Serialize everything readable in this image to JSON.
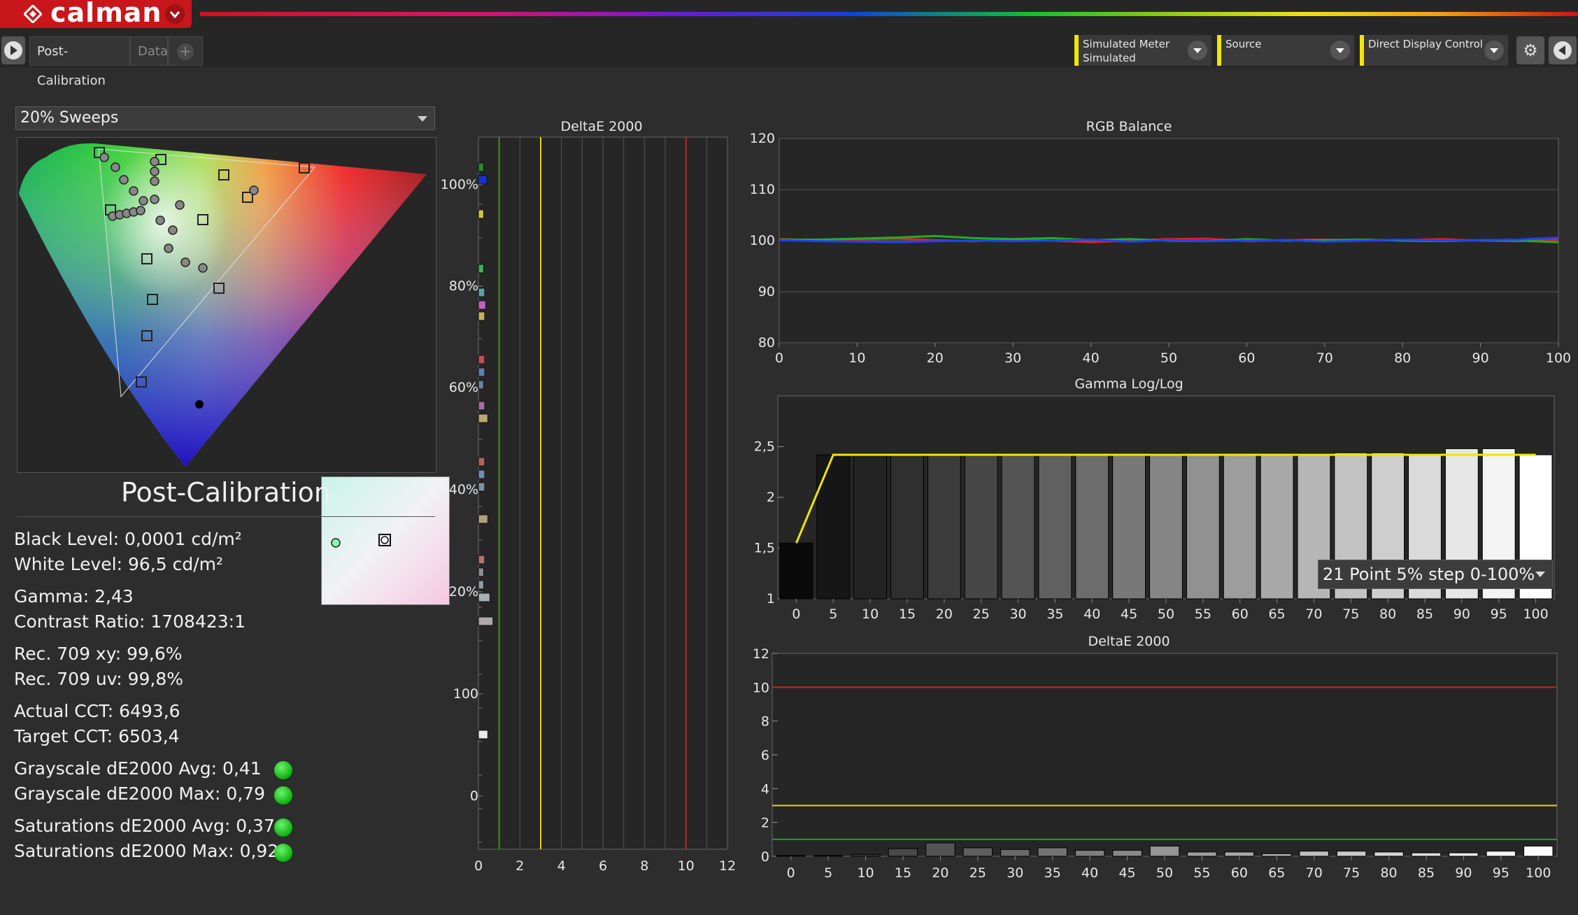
{
  "app": {
    "name": "calman"
  },
  "tabs": [
    {
      "label": "Post-Calibration",
      "active": true
    },
    {
      "label": "Data",
      "active": false
    }
  ],
  "devices": {
    "meter_label": "Simulated Meter",
    "meter_value": "Simulated",
    "source_label": "Source",
    "display_label": "Direct Display Control"
  },
  "sweep": {
    "selected": "20% Sweeps"
  },
  "panel": {
    "title": "Post-Calibration",
    "black_level": "Black Level: 0,0001 cd/m²",
    "white_level": "White Level: 96,5 cd/m²",
    "gamma": "Gamma: 2,43",
    "contrast": "Contrast Ratio: 1708423:1",
    "rec709_xy": "Rec. 709 xy: 99,6%",
    "rec709_uv": "Rec. 709 uv: 99,8%",
    "actual_cct": "Actual CCT: 6493,6",
    "target_cct": "Target CCT: 6503,4",
    "gs_avg": "Grayscale dE2000 Avg: 0,41",
    "gs_max": "Grayscale dE2000 Max: 0,79",
    "sat_avg": "Saturations dE2000 Avg: 0,37",
    "sat_max": "Saturations dE2000 Max: 0,92",
    "status_color": "#1ebe1e"
  },
  "gamma_select": {
    "selected": "21 Point 5% step 0-100%"
  },
  "chart_data": [
    {
      "type": "bar",
      "title": "DeltaE 2000",
      "orientation": "horizontal",
      "xlim": [
        0,
        12
      ],
      "xticks": [
        "0",
        "2",
        "4",
        "6",
        "8",
        "10",
        "12"
      ],
      "ytick_labels": [
        "100%",
        "80%",
        "60%",
        "40%",
        "20%",
        "100",
        "0"
      ],
      "thresholds": [
        {
          "value": 1,
          "color": "#20a020"
        },
        {
          "value": 3,
          "color": "#e6d600"
        },
        {
          "value": 10,
          "color": "#d02020"
        }
      ],
      "bars": [
        {
          "value": 0.25,
          "color": "#2a8a2a"
        },
        {
          "value": 0.4,
          "color": "#1a30d0"
        },
        {
          "value": 0.25,
          "color": "#c8c840"
        },
        {
          "value": 0.25,
          "color": "#40b060"
        },
        {
          "value": 0.3,
          "color": "#60a0a0"
        },
        {
          "value": 0.35,
          "color": "#c060c0"
        },
        {
          "value": 0.3,
          "color": "#c8b060"
        },
        {
          "value": 0.3,
          "color": "#c05050"
        },
        {
          "value": 0.3,
          "color": "#6080b0"
        },
        {
          "value": 0.25,
          "color": "#7080a0"
        },
        {
          "value": 0.3,
          "color": "#a070a0"
        },
        {
          "value": 0.45,
          "color": "#b8a870"
        },
        {
          "value": 0.3,
          "color": "#b06060"
        },
        {
          "value": 0.3,
          "color": "#7090b0"
        },
        {
          "value": 0.3,
          "color": "#8090a0"
        },
        {
          "value": 0.45,
          "color": "#b0a080"
        },
        {
          "value": 0.3,
          "color": "#b07070"
        },
        {
          "value": 0.25,
          "color": "#909090"
        },
        {
          "value": 0.25,
          "color": "#909aa8"
        },
        {
          "value": 0.55,
          "color": "#a8b0b8"
        },
        {
          "value": 0.7,
          "color": "#b0a8a8"
        },
        {
          "value": 0.45,
          "color": "#e8e8e8"
        }
      ]
    },
    {
      "type": "line",
      "title": "RGB Balance",
      "x": [
        0,
        5,
        10,
        15,
        20,
        25,
        30,
        35,
        40,
        45,
        50,
        55,
        60,
        65,
        70,
        75,
        80,
        85,
        90,
        95,
        100
      ],
      "xlim": [
        0,
        100
      ],
      "ylim": [
        80,
        120
      ],
      "xticks": [
        "0",
        "10",
        "20",
        "30",
        "40",
        "50",
        "60",
        "70",
        "80",
        "90",
        "100"
      ],
      "yticks": [
        "80",
        "90",
        "100",
        "110",
        "120"
      ],
      "series": [
        {
          "color": "#e02020",
          "values": [
            100.3,
            100.1,
            100.2,
            100.4,
            100.1,
            99.9,
            100.2,
            100.0,
            99.7,
            100.0,
            100.3,
            100.4,
            99.9,
            100.1,
            100.2,
            100.0,
            100.1,
            100.3,
            100.0,
            99.9,
            100.2
          ]
        },
        {
          "color": "#20b020",
          "values": [
            100.2,
            100.2,
            100.4,
            100.6,
            100.9,
            100.5,
            100.3,
            100.5,
            100.1,
            100.3,
            100.0,
            99.9,
            100.3,
            100.0,
            100.1,
            100.2,
            100.0,
            99.9,
            100.1,
            100.0,
            99.7
          ]
        },
        {
          "color": "#2040ff",
          "values": [
            100.1,
            99.9,
            99.8,
            99.7,
            99.9,
            100.0,
            99.9,
            100.0,
            100.2,
            99.8,
            100.1,
            99.9,
            100.0,
            100.1,
            99.8,
            100.0,
            100.2,
            100.0,
            100.1,
            100.2,
            100.6
          ]
        }
      ]
    },
    {
      "type": "bar",
      "title": "Gamma Log/Log",
      "categories": [
        "0",
        "5",
        "10",
        "15",
        "20",
        "25",
        "30",
        "35",
        "40",
        "45",
        "50",
        "55",
        "60",
        "65",
        "70",
        "75",
        "80",
        "85",
        "90",
        "95",
        "100"
      ],
      "ylim": [
        1,
        3
      ],
      "yticks": [
        "1",
        "1,5",
        "2",
        "2,5"
      ],
      "values": [
        1.55,
        2.42,
        2.42,
        2.42,
        2.42,
        2.42,
        2.42,
        2.42,
        2.42,
        2.42,
        2.43,
        2.42,
        2.42,
        2.42,
        2.43,
        2.44,
        2.44,
        2.43,
        2.48,
        2.48,
        2.42
      ],
      "target": [
        1.55,
        2.42,
        2.42,
        2.42,
        2.42,
        2.42,
        2.42,
        2.42,
        2.42,
        2.42,
        2.42,
        2.42,
        2.42,
        2.42,
        2.42,
        2.42,
        2.42,
        2.42,
        2.42,
        2.42,
        2.42
      ],
      "target_color": "#f0e600"
    },
    {
      "type": "bar",
      "title": "DeltaE 2000",
      "categories": [
        "0",
        "5",
        "10",
        "15",
        "20",
        "25",
        "30",
        "35",
        "40",
        "45",
        "50",
        "55",
        "60",
        "65",
        "70",
        "75",
        "80",
        "85",
        "90",
        "95",
        "100"
      ],
      "ylim": [
        0,
        12
      ],
      "yticks": [
        "0",
        "2",
        "4",
        "6",
        "8",
        "10",
        "12"
      ],
      "values": [
        0.0,
        0.05,
        0.1,
        0.45,
        0.79,
        0.5,
        0.4,
        0.5,
        0.35,
        0.35,
        0.6,
        0.25,
        0.25,
        0.15,
        0.3,
        0.3,
        0.25,
        0.2,
        0.2,
        0.3,
        0.6
      ],
      "thresholds": [
        {
          "value": 1,
          "color": "#20a020"
        },
        {
          "value": 3,
          "color": "#e6d600"
        },
        {
          "value": 10,
          "color": "#d02020"
        }
      ]
    }
  ]
}
